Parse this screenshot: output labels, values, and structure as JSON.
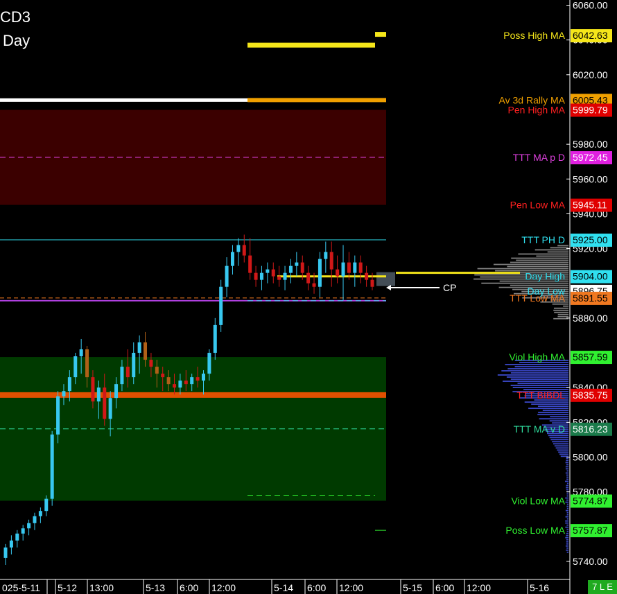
{
  "title": {
    "line1": "CD3",
    "line2": "Day"
  },
  "colors": {
    "background": "#000000",
    "up_candle": "#38c8f0",
    "down_candle": "#d01818",
    "neutral_candle": "#b06018",
    "zone_red": "#3b0000",
    "zone_green": "#003a00"
  },
  "chart_data": {
    "type": "candlestick",
    "ylim": [
      5730,
      6063
    ],
    "y_ticks": [
      {
        "v": 6060,
        "label": "6060.00"
      },
      {
        "v": 6040,
        "label": "6040.00"
      },
      {
        "v": 6020,
        "label": "6020.00"
      },
      {
        "v": 5980,
        "label": "5980.00"
      },
      {
        "v": 5960,
        "label": "5960.00"
      },
      {
        "v": 5940,
        "label": "5940.00"
      },
      {
        "v": 5920,
        "label": "5920.00"
      },
      {
        "v": 5880,
        "label": "5880.00"
      },
      {
        "v": 5840,
        "label": "5840.00"
      },
      {
        "v": 5820,
        "label": "5820.00"
      },
      {
        "v": 5800,
        "label": "5800.00"
      },
      {
        "v": 5780,
        "label": "5780.00"
      },
      {
        "v": 5740,
        "label": "5740.00"
      }
    ],
    "x_labels": [
      "025-5-11",
      "5-12",
      "13:00",
      "5-13",
      "6:00",
      "12:00",
      "5-14",
      "6:00",
      "12:00",
      "5-15",
      "6:00",
      "12:00",
      "5-16"
    ],
    "levels": [
      {
        "name": "Poss High MA",
        "value": 6042.63,
        "label": "6042.63",
        "text_color": "#f5e61a",
        "badge_bg": "#f5e61a",
        "badge_fg": "#000000"
      },
      {
        "name": "Av 3d Rally MA",
        "value": 6005.43,
        "label": "6005.43",
        "text_color": "#f0a000",
        "badge_bg": "#f0a000",
        "badge_fg": "#000000"
      },
      {
        "name": "Pen High MA",
        "value": 5999.79,
        "label": "5999.79",
        "text_color": "#ff2020",
        "badge_bg": "#e00000",
        "badge_fg": "#ffffff"
      },
      {
        "name": "TTT MA p D",
        "value": 5972.45,
        "label": "5972.45",
        "text_color": "#e040e0",
        "badge_bg": "#e020e0",
        "badge_fg": "#ffffff"
      },
      {
        "name": "Pen Low MA",
        "value": 5945.11,
        "label": "5945.11",
        "text_color": "#ff2020",
        "badge_bg": "#e00000",
        "badge_fg": "#ffffff"
      },
      {
        "name": "TTT PH D",
        "value": 5925.0,
        "label": "5925.00",
        "text_color": "#30e0f0",
        "badge_bg": "#30e0f0",
        "badge_fg": "#000000"
      },
      {
        "name": "Day High",
        "value": 5904.0,
        "label": "5904.00",
        "text_color": "#30e0f0",
        "badge_bg": "#30e0f0",
        "badge_fg": "#000000"
      },
      {
        "name": "Day Low",
        "value": 5896.75,
        "label": "5896.75",
        "text_color": "#30e0f0",
        "badge_bg": "#ffffff",
        "badge_fg": "#000000"
      },
      {
        "name": "TTT Low MA",
        "value": 5891.55,
        "label": "5891.55",
        "text_color": "#f07820",
        "badge_bg": "#f07820",
        "badge_fg": "#000000"
      },
      {
        "name": "Viol High MA",
        "value": 5857.59,
        "label": "5857.59",
        "text_color": "#30f030",
        "badge_bg": "#30f030",
        "badge_fg": "#000000"
      },
      {
        "name": "TTT BIBDL",
        "value": 5835.75,
        "label": "5835.75",
        "text_color": "#ff2020",
        "badge_bg": "#e00000",
        "badge_fg": "#ffffff"
      },
      {
        "name": "TTT MA v D",
        "value": 5816.23,
        "label": "5816.23",
        "text_color": "#30e0a0",
        "badge_bg": "#1a7a4a",
        "badge_fg": "#ffffff"
      },
      {
        "name": "Viol Low MA",
        "value": 5774.87,
        "label": "5774.87",
        "text_color": "#30f030",
        "badge_bg": "#30f030",
        "badge_fg": "#000000"
      },
      {
        "name": "Poss Low MA",
        "value": 5757.87,
        "label": "5757.87",
        "text_color": "#30f030",
        "badge_bg": "#30f030",
        "badge_fg": "#000000"
      }
    ],
    "current_price": {
      "label": "CP",
      "value": 5897.5
    },
    "candles": [
      [
        5742,
        5750,
        5738,
        5748
      ],
      [
        5748,
        5755,
        5744,
        5752
      ],
      [
        5752,
        5758,
        5748,
        5756
      ],
      [
        5756,
        5761,
        5752,
        5759
      ],
      [
        5759,
        5764,
        5755,
        5762
      ],
      [
        5762,
        5768,
        5758,
        5766
      ],
      [
        5766,
        5771,
        5762,
        5769
      ],
      [
        5769,
        5778,
        5766,
        5776
      ],
      [
        5776,
        5815,
        5772,
        5813
      ],
      [
        5813,
        5838,
        5808,
        5835
      ],
      [
        5835,
        5842,
        5830,
        5838
      ],
      [
        5838,
        5850,
        5832,
        5846
      ],
      [
        5846,
        5860,
        5842,
        5858
      ],
      [
        5858,
        5868,
        5848,
        5862
      ],
      [
        5862,
        5864,
        5840,
        5846
      ],
      [
        5846,
        5850,
        5828,
        5832
      ],
      [
        5832,
        5844,
        5822,
        5840
      ],
      [
        5840,
        5848,
        5818,
        5822
      ],
      [
        5822,
        5838,
        5812,
        5834
      ],
      [
        5834,
        5846,
        5828,
        5842
      ],
      [
        5842,
        5856,
        5838,
        5852
      ],
      [
        5852,
        5862,
        5840,
        5846
      ],
      [
        5846,
        5866,
        5842,
        5860
      ],
      [
        5860,
        5870,
        5848,
        5866
      ],
      [
        5866,
        5872,
        5852,
        5856
      ],
      [
        5856,
        5860,
        5846,
        5852
      ],
      [
        5852,
        5856,
        5840,
        5848
      ],
      [
        5848,
        5852,
        5838,
        5846
      ],
      [
        5846,
        5850,
        5838,
        5842
      ],
      [
        5842,
        5848,
        5836,
        5840
      ],
      [
        5840,
        5848,
        5836,
        5844
      ],
      [
        5844,
        5850,
        5838,
        5842
      ],
      [
        5842,
        5848,
        5838,
        5846
      ],
      [
        5846,
        5852,
        5840,
        5844
      ],
      [
        5844,
        5850,
        5836,
        5848
      ],
      [
        5848,
        5862,
        5844,
        5860
      ],
      [
        5860,
        5880,
        5856,
        5876
      ],
      [
        5876,
        5902,
        5872,
        5898
      ],
      [
        5898,
        5915,
        5892,
        5910
      ],
      [
        5910,
        5922,
        5905,
        5918
      ],
      [
        5918,
        5926,
        5910,
        5922
      ],
      [
        5922,
        5928,
        5912,
        5916
      ],
      [
        5916,
        5926,
        5902,
        5906
      ],
      [
        5906,
        5910,
        5898,
        5902
      ],
      [
        5902,
        5910,
        5896,
        5906
      ],
      [
        5906,
        5912,
        5900,
        5908
      ],
      [
        5908,
        5912,
        5900,
        5904
      ],
      [
        5904,
        5910,
        5898,
        5902
      ],
      [
        5902,
        5910,
        5896,
        5906
      ],
      [
        5906,
        5914,
        5900,
        5910
      ],
      [
        5910,
        5918,
        5904,
        5912
      ],
      [
        5912,
        5916,
        5902,
        5906
      ],
      [
        5906,
        5910,
        5896,
        5900
      ],
      [
        5900,
        5906,
        5894,
        5898
      ],
      [
        5898,
        5918,
        5892,
        5914
      ],
      [
        5914,
        5924,
        5906,
        5918
      ],
      [
        5918,
        5924,
        5898,
        5908
      ],
      [
        5908,
        5916,
        5900,
        5904
      ],
      [
        5904,
        5922,
        5890,
        5912
      ],
      [
        5912,
        5918,
        5902,
        5906
      ],
      [
        5906,
        5916,
        5898,
        5912
      ],
      [
        5912,
        5916,
        5900,
        5906
      ],
      [
        5906,
        5910,
        5898,
        5902
      ],
      [
        5902,
        5906,
        5896,
        5898
      ]
    ]
  },
  "footer": {
    "badge": "7 L E"
  }
}
